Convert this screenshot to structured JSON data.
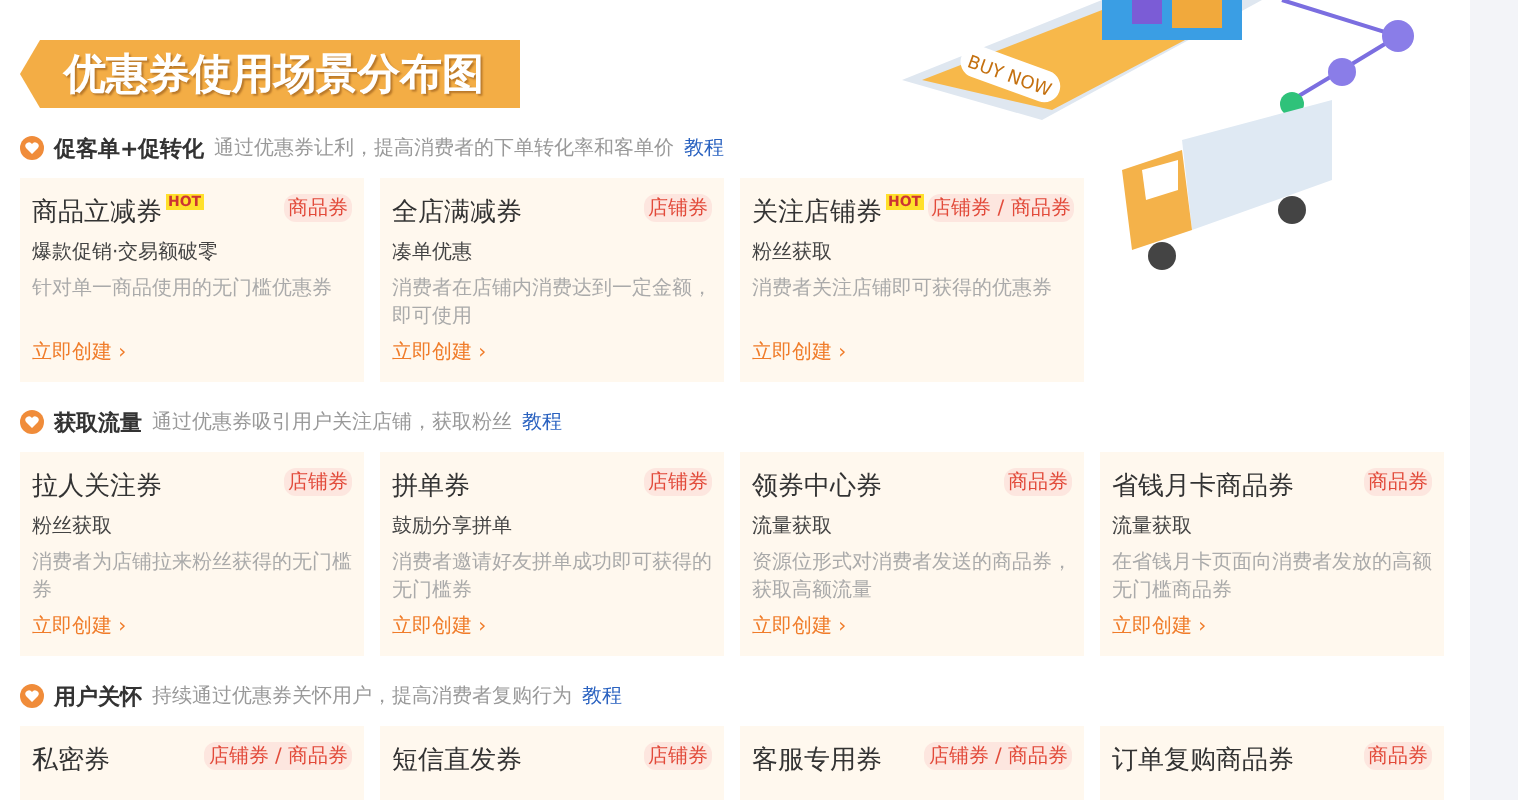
{
  "banner": {
    "title": "优惠券使用场景分布图"
  },
  "illustration": {
    "button_text": "BUY NOW"
  },
  "sections": [
    {
      "title": "促客单+促转化",
      "desc": "通过优惠券让利，提高消费者的下单转化率和客单价",
      "link": "教程",
      "cards": [
        {
          "title": "商品立减券",
          "badge": "HOT",
          "tag": "商品券",
          "subtitle": "爆款促销·交易额破零",
          "desc": "针对单一商品使用的无门槛优惠券",
          "action": "立即创建 ›"
        },
        {
          "title": "全店满减券",
          "tag": "店铺券",
          "subtitle": "凑单优惠",
          "desc": "消费者在店铺内消费达到一定金额，即可使用",
          "action": "立即创建 ›"
        },
        {
          "title": "关注店铺券",
          "badge": "HOT",
          "tag": "店铺券 / 商品券",
          "subtitle": "粉丝获取",
          "desc": "消费者关注店铺即可获得的优惠券",
          "action": "立即创建 ›"
        }
      ]
    },
    {
      "title": "获取流量",
      "desc": "通过优惠券吸引用户关注店铺，获取粉丝",
      "link": "教程",
      "cards": [
        {
          "title": "拉人关注券",
          "tag": "店铺券",
          "subtitle": "粉丝获取",
          "desc": "消费者为店铺拉来粉丝获得的无门槛券",
          "action": "立即创建 ›"
        },
        {
          "title": "拼单券",
          "tag": "店铺券",
          "subtitle": "鼓励分享拼单",
          "desc": "消费者邀请好友拼单成功即可获得的无门槛券",
          "action": "立即创建 ›"
        },
        {
          "title": "领券中心券",
          "tag": "商品券",
          "subtitle": "流量获取",
          "desc": "资源位形式对消费者发送的商品券，获取高额流量",
          "action": "立即创建 ›"
        },
        {
          "title": "省钱月卡商品券",
          "tag": "商品券",
          "subtitle": "流量获取",
          "desc": "在省钱月卡页面向消费者发放的高额无门槛商品券",
          "action": "立即创建 ›"
        }
      ]
    },
    {
      "title": "用户关怀",
      "desc": "持续通过优惠券关怀用户，提高消费者复购行为",
      "link": "教程",
      "cards": [
        {
          "title": "私密券",
          "tag": "店铺券 / 商品券"
        },
        {
          "title": "短信直发券",
          "tag": "店铺券"
        },
        {
          "title": "客服专用券",
          "tag": "店铺券 / 商品券"
        },
        {
          "title": "订单复购商品券",
          "tag": "商品券"
        }
      ]
    }
  ]
}
